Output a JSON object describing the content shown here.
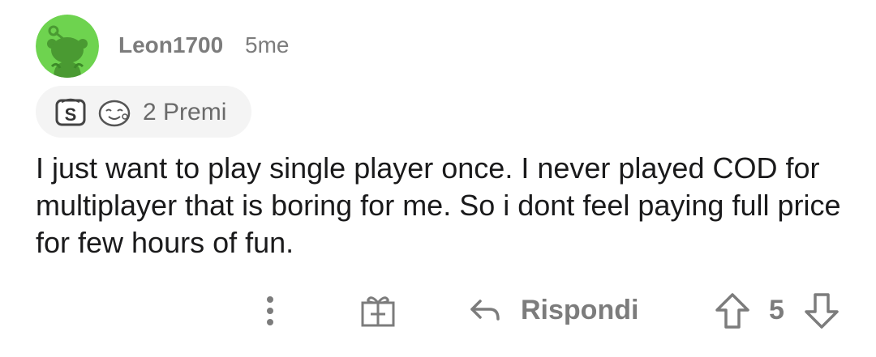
{
  "comment": {
    "author": "Leon1700",
    "timestamp": "5me",
    "body": "I just want to play single player once. I never played COD for multiplayer that is boring for me. So i dont feel paying full price for few hours of fun."
  },
  "awards": {
    "count_label": "2 Premi",
    "icons": [
      "silver-award-icon",
      "wholesome-award-icon"
    ]
  },
  "actions": {
    "more_icon": "more-vertical-icon",
    "gift_icon": "gift-award-icon",
    "reply_icon": "reply-arrow-icon",
    "reply_label": "Rispondi",
    "upvote_icon": "upvote-arrow-icon",
    "score": "5",
    "downvote_icon": "downvote-arrow-icon"
  },
  "colors": {
    "avatar_bg": "#6ed34f",
    "avatar_snoo": "#4a9a32",
    "meta_text": "#7c7c7c",
    "body_text": "#1a1a1b",
    "awards_bg": "#f4f4f4"
  }
}
